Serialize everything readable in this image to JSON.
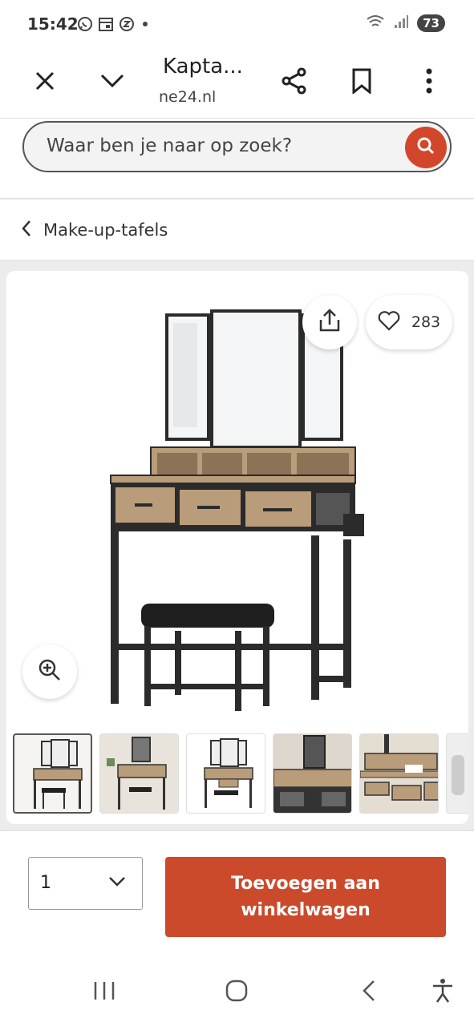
{
  "status_bar": {
    "time": "15:42",
    "battery": "73",
    "icons": [
      "whatsapp-icon",
      "calendar-icon",
      "z-app-icon",
      "dot-icon",
      "wifi-icon",
      "signal-icon"
    ]
  },
  "browser": {
    "tab_title": "Kapta...",
    "url": "ne24.nl",
    "icons": [
      "close-icon",
      "chevron-down-icon",
      "share-icon",
      "bookmark-icon",
      "more-vert-icon"
    ]
  },
  "search": {
    "placeholder": "Waar ben je naar op zoek?",
    "button_icon": "search-icon"
  },
  "breadcrumb": {
    "label": "Make-up-tafels",
    "icon": "chevron-left-icon"
  },
  "product": {
    "likes": "283",
    "thumbnail_count": 6,
    "selected_thumbnail": 1,
    "icons": [
      "share-icon",
      "heart-icon",
      "zoom-in-icon"
    ]
  },
  "cart": {
    "quantity": "1",
    "button_label": "Toevoegen aan winkelwagen"
  },
  "colors": {
    "accent": "#cc4a2c",
    "search_button": "#d2472c",
    "wood": "#b99c7a",
    "frame": "#2b2b2b"
  },
  "nav": {
    "icons": [
      "recents-icon",
      "home-icon",
      "back-icon",
      "accessibility-icon"
    ]
  }
}
